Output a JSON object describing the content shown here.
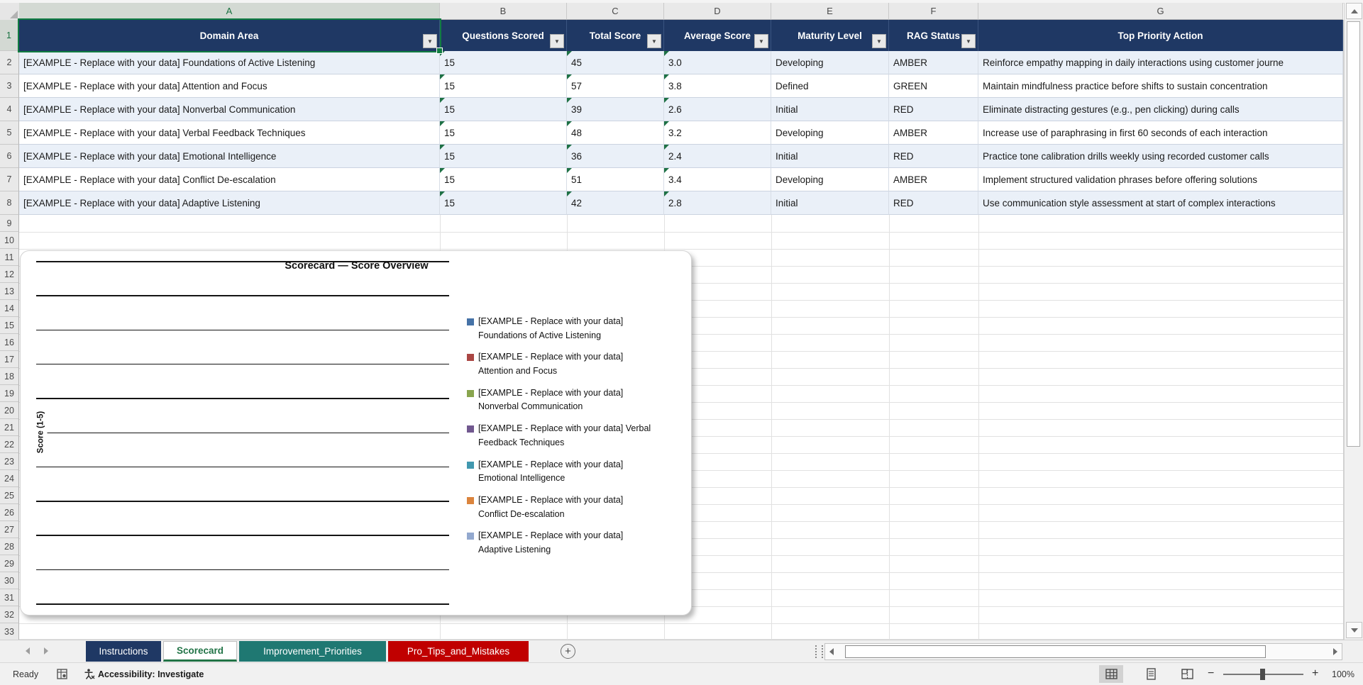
{
  "sheet": {
    "column_letters": [
      "A",
      "B",
      "C",
      "D",
      "E",
      "F",
      "G"
    ],
    "row_numbers": [
      "1",
      "2",
      "3",
      "4",
      "5",
      "6",
      "7",
      "8",
      "9",
      "10",
      "11",
      "12",
      "13",
      "14",
      "15",
      "16",
      "17",
      "18",
      "19",
      "20",
      "21",
      "22",
      "23",
      "24",
      "25",
      "26",
      "27",
      "28",
      "29",
      "30",
      "31",
      "32",
      "33"
    ],
    "selected_cell": "A1"
  },
  "table": {
    "headers": [
      "Domain Area",
      "Questions Scored",
      "Total Score",
      "Average Score",
      "Maturity Level",
      "RAG Status",
      "Top Priority Action"
    ],
    "rows": [
      {
        "domain": "[EXAMPLE - Replace with your data] Foundations of Active Listening",
        "questions": "15",
        "total": "45",
        "average": "3.0",
        "maturity": "Developing",
        "rag": "AMBER",
        "action": "Reinforce empathy mapping in daily interactions using customer journe"
      },
      {
        "domain": "[EXAMPLE - Replace with your data] Attention and Focus",
        "questions": "15",
        "total": "57",
        "average": "3.8",
        "maturity": "Defined",
        "rag": "GREEN",
        "action": "Maintain mindfulness practice before shifts to sustain concentration"
      },
      {
        "domain": "[EXAMPLE - Replace with your data] Nonverbal Communication",
        "questions": "15",
        "total": "39",
        "average": "2.6",
        "maturity": "Initial",
        "rag": "RED",
        "action": "Eliminate distracting gestures (e.g., pen clicking) during calls"
      },
      {
        "domain": "[EXAMPLE - Replace with your data] Verbal Feedback Techniques",
        "questions": "15",
        "total": "48",
        "average": "3.2",
        "maturity": "Developing",
        "rag": "AMBER",
        "action": "Increase use of paraphrasing in first 60 seconds of each interaction"
      },
      {
        "domain": "[EXAMPLE - Replace with your data] Emotional Intelligence",
        "questions": "15",
        "total": "36",
        "average": "2.4",
        "maturity": "Initial",
        "rag": "RED",
        "action": "Practice tone calibration drills weekly using recorded customer calls"
      },
      {
        "domain": "[EXAMPLE - Replace with your data] Conflict De-escalation",
        "questions": "15",
        "total": "51",
        "average": "3.4",
        "maturity": "Developing",
        "rag": "AMBER",
        "action": "Implement structured validation phrases before offering solutions"
      },
      {
        "domain": "[EXAMPLE - Replace with your data] Adaptive Listening",
        "questions": "15",
        "total": "42",
        "average": "2.8",
        "maturity": "Initial",
        "rag": "RED",
        "action": "Use communication style assessment at start of complex interactions"
      }
    ]
  },
  "chart": {
    "title": "Scorecard — Score Overview",
    "y_axis_label": "Score (1-5)",
    "legend": [
      {
        "color": "#4572A7",
        "line1": "[EXAMPLE - Replace with your data]",
        "line2": "Foundations of Active Listening"
      },
      {
        "color": "#AA4643",
        "line1": "[EXAMPLE - Replace with your data]",
        "line2": "Attention and Focus"
      },
      {
        "color": "#89A54E",
        "line1": "[EXAMPLE - Replace with your data]",
        "line2": "Nonverbal Communication"
      },
      {
        "color": "#71588F",
        "line1": "[EXAMPLE - Replace with your data] Verbal",
        "line2": "Feedback Techniques"
      },
      {
        "color": "#4198AF",
        "line1": "[EXAMPLE - Replace with your data]",
        "line2": "Emotional Intelligence"
      },
      {
        "color": "#DB843D",
        "line1": "[EXAMPLE - Replace with your data]",
        "line2": "Conflict De-escalation"
      },
      {
        "color": "#93A9CF",
        "line1": "[EXAMPLE - Replace with your data]",
        "line2": "Adaptive Listening"
      }
    ]
  },
  "chart_data": {
    "type": "bar",
    "title": "Scorecard — Score Overview",
    "ylabel": "Score (1-5)",
    "ylim": [
      0,
      5
    ],
    "gridlines": 11,
    "grid": true,
    "legend_position": "right",
    "series": [
      {
        "name": "[EXAMPLE - Replace with your data] Foundations of Active Listening",
        "color": "#4572A7"
      },
      {
        "name": "[EXAMPLE - Replace with your data] Attention and Focus",
        "color": "#AA4643"
      },
      {
        "name": "[EXAMPLE - Replace with your data] Nonverbal Communication",
        "color": "#89A54E"
      },
      {
        "name": "[EXAMPLE - Replace with your data] Verbal Feedback Techniques",
        "color": "#71588F"
      },
      {
        "name": "[EXAMPLE - Replace with your data] Emotional Intelligence",
        "color": "#4198AF"
      },
      {
        "name": "[EXAMPLE - Replace with your data] Conflict De-escalation",
        "color": "#DB843D"
      },
      {
        "name": "[EXAMPLE - Replace with your data] Adaptive Listening",
        "color": "#93A9CF"
      }
    ],
    "values_rendered": "none — plot area shows only horizontal gridlines, no bars drawn"
  },
  "tabs": {
    "items": [
      {
        "label": "Instructions",
        "fill": "#1F3864",
        "text_color": "#FFFFFF",
        "active": false
      },
      {
        "label": "Scorecard",
        "fill": "#FFFFFF",
        "text_color": "#217346",
        "active": true
      },
      {
        "label": "Improvement_Priorities",
        "fill": "#1F7872",
        "text_color": "#FFFFFF",
        "active": false
      },
      {
        "label": "Pro_Tips_and_Mistakes",
        "fill": "#C00000",
        "text_color": "#FFFFFF",
        "active": false
      }
    ],
    "new_sheet_label": "+"
  },
  "status_bar": {
    "ready": "Ready",
    "accessibility_label": "Accessibility: Investigate",
    "zoom_out": "−",
    "zoom_in": "+",
    "zoom_level": "100%"
  },
  "icons": {
    "filter_arrow": "▼",
    "select_all": "corner-triangle",
    "macro_record": "grid-sheet-icon",
    "accessibility": "person-icon",
    "views": [
      "normal-view",
      "page-layout-view",
      "page-break-preview"
    ]
  },
  "colors": {
    "table_header_fill": "#1F3864",
    "banded_row_fill": "#EAF0F8",
    "selection_green": "#107C41",
    "active_tab_green": "#217346"
  }
}
